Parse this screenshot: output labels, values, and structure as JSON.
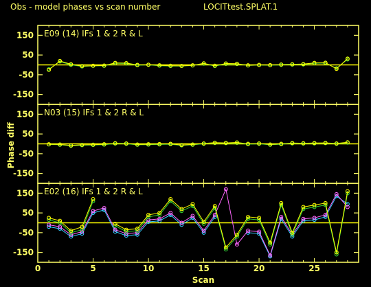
{
  "chart_data": {
    "type": "line",
    "title": "Obs - model phases vs scan number",
    "source_label": "LOCITtest.SPLAT.1",
    "xlabel": "Scan",
    "ylabel": "Phase diff",
    "xlim": [
      0,
      29
    ],
    "x_ticks": [
      0,
      5,
      10,
      15,
      20,
      25
    ],
    "ylim": [
      -200,
      200
    ],
    "y_ticks": [
      150,
      50,
      -50,
      -150
    ],
    "colors": {
      "background": "#000000",
      "frame": "#ffff66",
      "text": "#ffff66",
      "zero_line": "#ffff00",
      "series": [
        "#ffff00",
        "#33cc33",
        "#ff66ff",
        "#33ccff"
      ]
    },
    "panels": [
      {
        "label": "E09 (14)  IFs 1 & 2  R & L",
        "series": [
          {
            "x": [
              1,
              2,
              3,
              4,
              5,
              6,
              7,
              8,
              9,
              10,
              11,
              12,
              13,
              14,
              15,
              16,
              17,
              18,
              19,
              20,
              21,
              22,
              23,
              24,
              25,
              26,
              27,
              28
            ],
            "values": [
              -25,
              20,
              3,
              -6,
              -4,
              -3,
              10,
              9,
              0,
              1,
              -2,
              -4,
              -5,
              -2,
              8,
              -4,
              7,
              6,
              -2,
              0,
              -1,
              2,
              3,
              4,
              10,
              11,
              -20,
              32
            ]
          },
          {
            "x": [
              1,
              2,
              3,
              4,
              5,
              6,
              7,
              8,
              9,
              10,
              11,
              12,
              13,
              14,
              15,
              16,
              17,
              18,
              19,
              20,
              21,
              22,
              23,
              24,
              25,
              26,
              27,
              28
            ],
            "values": [
              -22,
              17,
              0,
              -8,
              -5,
              -5,
              8,
              7,
              -2,
              0,
              -4,
              -6,
              -6,
              -3,
              6,
              -6,
              5,
              4,
              -3,
              -1,
              -2,
              0,
              1,
              2,
              8,
              9,
              -17,
              28
            ]
          }
        ]
      },
      {
        "label": "N03 (15)  IFs 1 & 2  R & L",
        "series": [
          {
            "x": [
              1,
              2,
              3,
              4,
              5,
              6,
              7,
              8,
              9,
              10,
              11,
              12,
              13,
              14,
              15,
              16,
              17,
              18,
              19,
              20,
              21,
              22,
              23,
              24,
              25,
              26,
              27,
              28
            ],
            "values": [
              -2,
              -3,
              -8,
              -5,
              -4,
              -2,
              3,
              2,
              -3,
              -2,
              -1,
              0,
              -6,
              -3,
              2,
              6,
              5,
              7,
              0,
              2,
              -3,
              0,
              4,
              3,
              4,
              5,
              2,
              8
            ]
          },
          {
            "x": [
              1,
              2,
              3,
              4,
              5,
              6,
              7,
              8,
              9,
              10,
              11,
              12,
              13,
              14,
              15,
              16,
              17,
              18,
              19,
              20,
              21,
              22,
              23,
              24,
              25,
              26,
              27,
              28
            ],
            "values": [
              -3,
              -5,
              -10,
              -7,
              -6,
              -4,
              1,
              0,
              -5,
              -4,
              -3,
              -2,
              -8,
              -5,
              0,
              4,
              3,
              5,
              -2,
              0,
              -5,
              -2,
              2,
              1,
              2,
              3,
              0,
              6
            ]
          }
        ]
      },
      {
        "label": "E02 (16)  IFs 1 & 2  R & L",
        "series": [
          {
            "name": "",
            "x": [
              1,
              2,
              3,
              4,
              5,
              6,
              7,
              8,
              9,
              10,
              11,
              12,
              13,
              14,
              15,
              16,
              17,
              18,
              19,
              20,
              21,
              22,
              23,
              24,
              25,
              26,
              27,
              28
            ],
            "values": [
              25,
              10,
              -40,
              -20,
              120,
              null,
              -5,
              -35,
              -30,
              40,
              50,
              120,
              70,
              95,
              5,
              85,
              -125,
              -60,
              30,
              25,
              -100,
              100,
              -50,
              80,
              90,
              100,
              -150,
              160
            ]
          },
          {
            "x": [
              1,
              2,
              3,
              4,
              5,
              6,
              7,
              8,
              9,
              10,
              11,
              12,
              13,
              14,
              15,
              16,
              17,
              18,
              19,
              20,
              21,
              22,
              23,
              24,
              25,
              26,
              27,
              28
            ],
            "values": [
              15,
              0,
              -50,
              -35,
              110,
              null,
              -15,
              -45,
              -40,
              30,
              40,
              110,
              60,
              85,
              -5,
              75,
              -135,
              -70,
              20,
              15,
              -110,
              90,
              -60,
              70,
              80,
              90,
              -160,
              150
            ]
          },
          {
            "x": [
              1,
              2,
              3,
              4,
              5,
              6,
              7,
              8,
              9,
              10,
              11,
              12,
              13,
              14,
              15,
              16,
              17,
              18,
              19,
              20,
              21,
              22,
              23,
              24,
              25,
              26,
              27,
              28
            ],
            "values": [
              -10,
              -20,
              -60,
              -45,
              60,
              75,
              -35,
              -55,
              -50,
              15,
              20,
              50,
              0,
              35,
              -40,
              40,
              170,
              -110,
              -40,
              -45,
              -165,
              30,
              -60,
              20,
              25,
              40,
              145,
              80
            ]
          },
          {
            "x": [
              1,
              2,
              3,
              4,
              5,
              6,
              7,
              8,
              9,
              10,
              11,
              12,
              13,
              14,
              15,
              16,
              17,
              18,
              19,
              20,
              21,
              22,
              23,
              24,
              25,
              26,
              27,
              28
            ],
            "values": [
              -20,
              -30,
              -70,
              -55,
              50,
              65,
              -45,
              -65,
              -60,
              5,
              10,
              40,
              -10,
              25,
              -50,
              30,
              null,
              null,
              -50,
              -55,
              -170,
              20,
              -70,
              10,
              15,
              30,
              135,
              95
            ]
          }
        ]
      }
    ]
  }
}
